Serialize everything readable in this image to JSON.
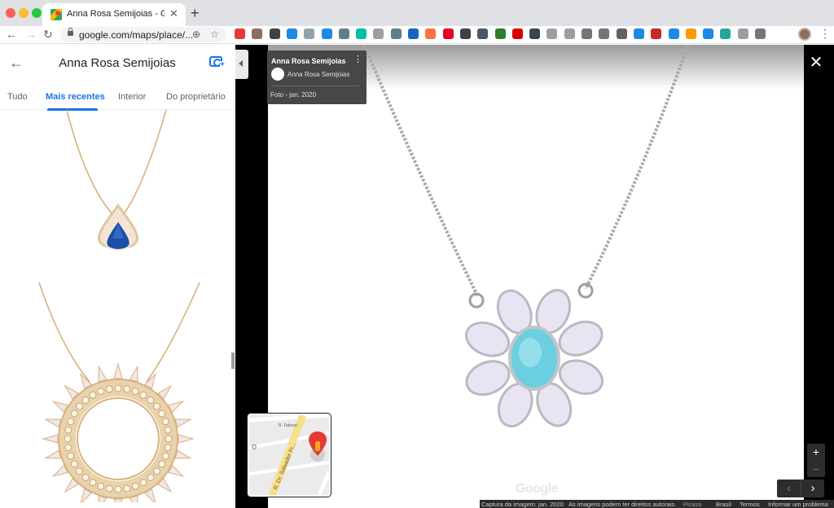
{
  "browser": {
    "tab_title": "Anna Rosa Semijoias - Google",
    "url": "google.com/maps/place/...",
    "new_tab": "+",
    "close_tab": "✕",
    "back": "←",
    "forward": "→",
    "reload": "↻",
    "colors": {
      "traffic_red": "#ff5f57",
      "traffic_yellow": "#febc2e",
      "traffic_green": "#28c840"
    },
    "extensions": [
      "color-wheel",
      "folder",
      "task",
      "chart",
      "code",
      "grid",
      "shield",
      "m-circle",
      "drive",
      "cloud",
      "trello",
      "calendar",
      "pinterest",
      "m-mail",
      "window",
      "evernote",
      "pocket",
      "tree",
      "square",
      "message",
      "camera",
      "rss",
      "game",
      "translate",
      "red-badge",
      "new-badge",
      "squiggle",
      "iq",
      "pl",
      "dots-grid",
      "puzzle"
    ],
    "ext_colors": [
      "#e53935",
      "#8d6e63",
      "#424242",
      "#1e88e5",
      "#90a4ae",
      "#1e88e5",
      "#607d8b",
      "#00bfa5",
      "#9e9e9e",
      "#607d8b",
      "#1565c0",
      "#ff7043",
      "#e60023",
      "#424242",
      "#455a64",
      "#2e7d32",
      "#d50000",
      "#37474f",
      "#9e9e9e",
      "#9e9e9e",
      "#757575",
      "#757575",
      "#616161",
      "#1e88e5",
      "#c62828",
      "#1e88e5",
      "#ff9800",
      "#1e88e5",
      "#26a69a",
      "#9e9e9e",
      "#757575"
    ]
  },
  "panel": {
    "title": "Anna Rosa Semijoias",
    "tabs": [
      "Tudo",
      "Mais recentes",
      "Interior",
      "Do proprietário"
    ],
    "active_tab": "Mais recentes"
  },
  "viewer": {
    "card_title": "Anna Rosa Semijoias",
    "card_subtitle": "Anna Rosa Semijoias",
    "card_date": "Foto - jan. 2020",
    "map_labels": [
      "R. Dr. Salvador Fr...",
      "R. Taborai",
      "o"
    ],
    "google_logo": "Google",
    "footer": [
      "Captura da imagem: jan. 2020",
      "As imagens podem ter direitos autorais.",
      "Picasa",
      "Brasil",
      "Termos",
      "Informar um problema"
    ],
    "zoom_in": "+",
    "zoom_out": "−",
    "prev": "‹",
    "next": "›",
    "close": "✕"
  }
}
